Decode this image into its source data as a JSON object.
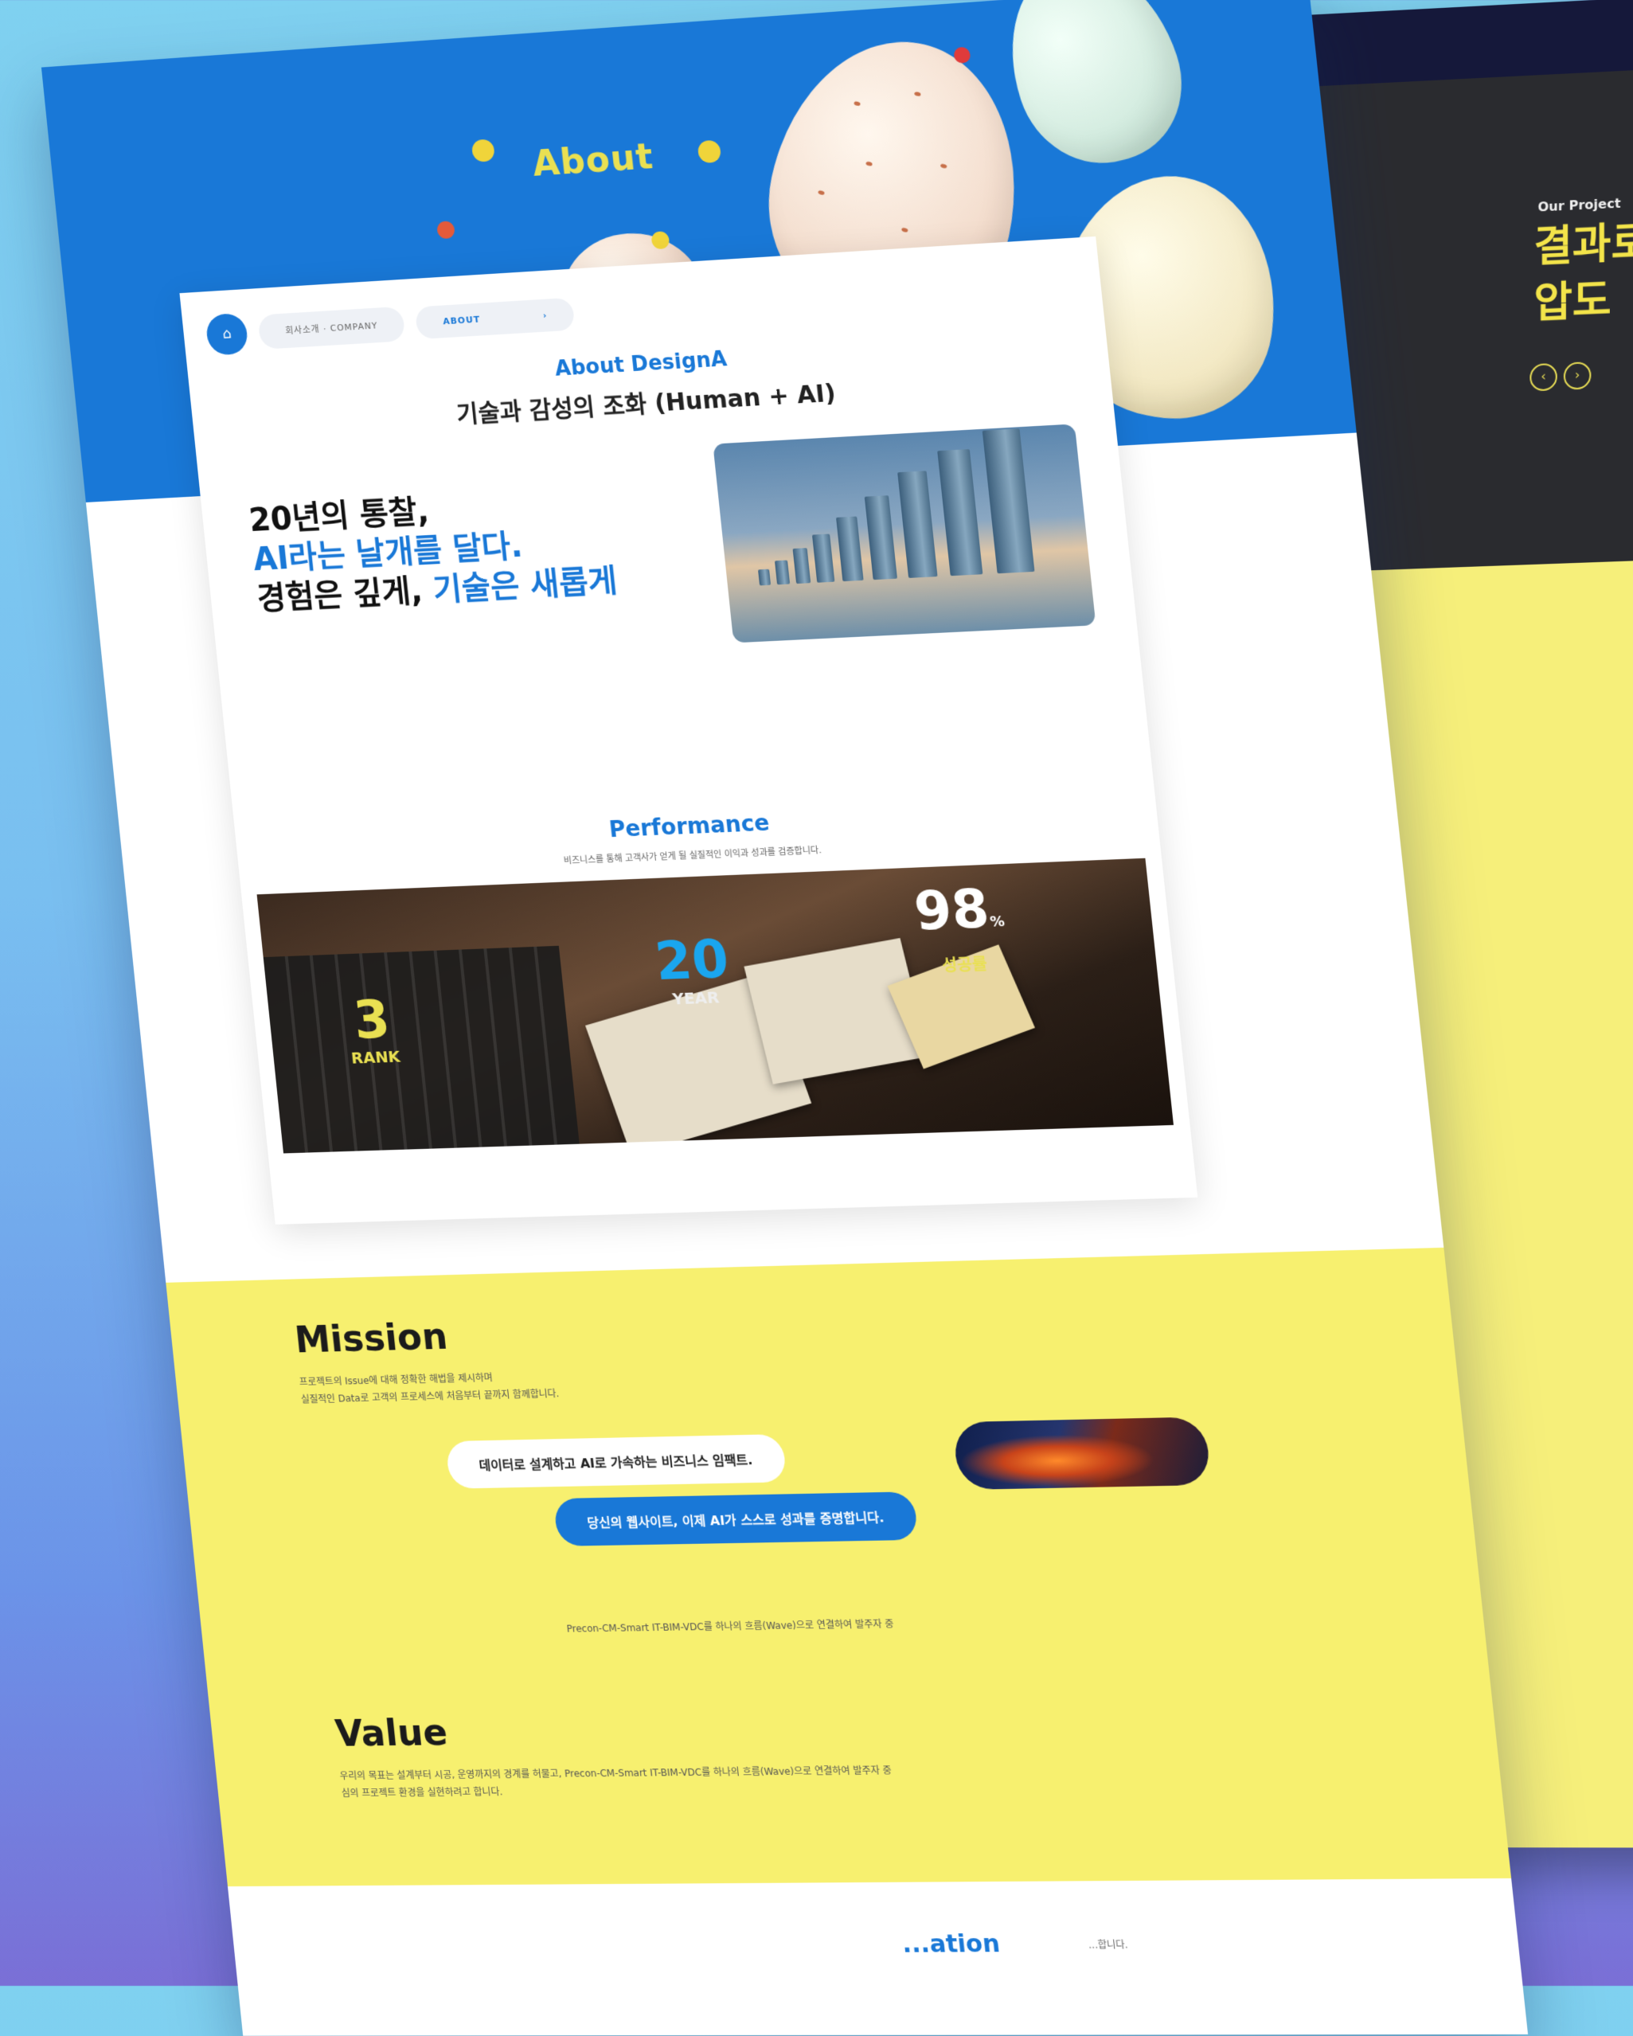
{
  "colors": {
    "primary": "#1978d7",
    "accent_yellow": "#f7f06f",
    "title_yellow": "#e9e052",
    "dark": "#2a2b2f"
  },
  "side_page": {
    "eyebrow": "Our Project",
    "title_line1": "결과로",
    "title_line2": "압도",
    "desc": "",
    "prev_icon": "arrow-left-icon",
    "next_icon": "arrow-right-icon"
  },
  "hero": {
    "title": "About",
    "subtitle": ""
  },
  "breadcrumb": {
    "home_icon": "home-icon",
    "path": "회사소개 · COMPANY",
    "current": "ABOUT",
    "chevron": "›"
  },
  "intro": {
    "eyebrow": "About DesignA",
    "title": "기술과 감성의 조화 (Human + AI)",
    "headline_line1": "20년의 통찰,",
    "headline_line2": "AI라는 날개를 달다.",
    "headline_line3_a": "경험은 깊게, ",
    "headline_line3_b": "기술은 새롭게",
    "desc": ""
  },
  "performance": {
    "eyebrow": "Performance",
    "desc": "비즈니스를 통해 고객사가 얻게 될 실질적인 이익과 성과를 검증합니다.",
    "stats": [
      {
        "value": "3",
        "unit": "",
        "label": "RANK"
      },
      {
        "value": "20",
        "unit": "",
        "label": "YEAR"
      },
      {
        "value": "98",
        "unit": "%",
        "label": "성공률"
      }
    ]
  },
  "mission": {
    "title": "Mission",
    "desc_line1": "프로젝트의 Issue에 대해 정확한 해법을 제시하며",
    "desc_line2": "실질적인 Data로 고객의 프로세스에 처음부터 끝까지 함께합니다.",
    "pill_white": "데이터로 설계하고 AI로 가속하는 비즈니스 임팩트.",
    "pill_blue": "당신의 웹사이트, 이제 AI가 스스로 성과를 증명합니다."
  },
  "value": {
    "intro": "Precon-CM-Smart IT-BIM-VDC를 하나의 흐름(Wave)으로 연결하여 발주자 중",
    "title": "Value",
    "desc_line1": "우리의 목표는 설계부터 시공, 운영까지의 경계를 허물고, Precon-CM-Smart IT-BIM-VDC를 하나의 흐름(Wave)으로 연결하여 발주자 중",
    "desc_line2": "심의 프로젝트 환경을 실현하려고 합니다."
  },
  "next_section": {
    "eyebrow": "...ation",
    "desc": "...합니다."
  }
}
